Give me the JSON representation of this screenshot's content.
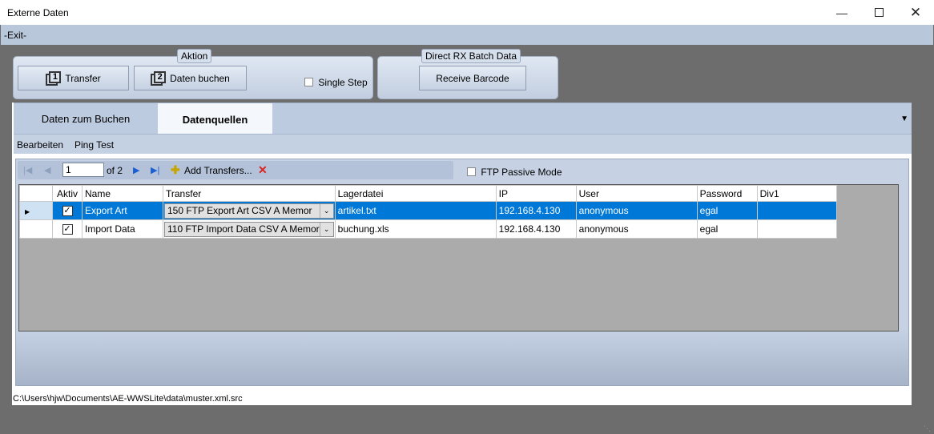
{
  "window": {
    "title": "Externe Daten"
  },
  "menu": {
    "exit": "-Exit-"
  },
  "aktion": {
    "title": "Aktion",
    "transfer_label": "Transfer",
    "daten_buchen_label": "Daten buchen",
    "transfer_num": "1",
    "buchen_num": "2",
    "single_step_label": "Single Step"
  },
  "direct_rx": {
    "title": "Direct RX Batch Data",
    "receive_label": "Receive Barcode"
  },
  "tabs": [
    {
      "label": "Daten zum Buchen"
    },
    {
      "label": "Datenquellen"
    }
  ],
  "subtoolbar": {
    "bearbeiten": "Bearbeiten",
    "ping_test": "Ping Test"
  },
  "navigator": {
    "position": "1",
    "count_text": "of 2",
    "add_transfers": "Add Transfers...",
    "ftp_passive_label": "FTP Passive Mode"
  },
  "grid": {
    "headers": [
      "Aktiv",
      "Name",
      "Transfer",
      "Lagerdatei",
      "IP",
      "User",
      "Password",
      "Div1"
    ],
    "rows": [
      {
        "aktiv": "✓",
        "name": "Export Art",
        "transfer": "150 FTP Export Art CSV A Memor",
        "lagerdatei": "artikel.txt",
        "ip": "192.168.4.130",
        "user": "anonymous",
        "password": "egal",
        "div1": ""
      },
      {
        "aktiv": "✓",
        "name": "Import Data",
        "transfer": "110 FTP Import Data CSV A Memor",
        "lagerdatei": "buchung.xls",
        "ip": "192.168.4.130",
        "user": "anonymous",
        "password": "egal",
        "div1": ""
      }
    ]
  },
  "status": {
    "path": "C:\\Users\\hjw\\Documents\\AE-WWSLite\\data\\muster.xml.src"
  },
  "colors": {
    "selection": "#0078d7",
    "background": "#6d6d6d",
    "ribbon": "#bccbe0"
  }
}
